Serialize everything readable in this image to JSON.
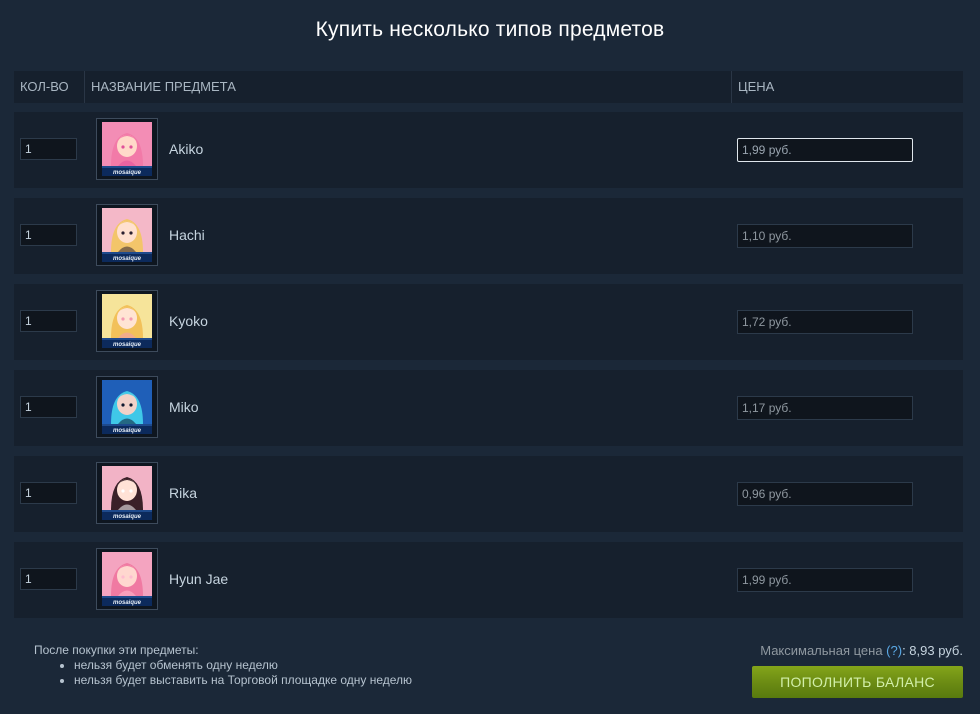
{
  "title": "Купить несколько типов предметов",
  "table": {
    "headers": {
      "qty": "КОЛ-ВО",
      "name": "НАЗВАНИЕ ПРЕДМЕТА",
      "price": "ЦЕНА"
    },
    "rows": [
      {
        "qty": "1",
        "name": "Akiko",
        "price": "1,99 руб.",
        "image": "card-portrait-akiko",
        "palette": {
          "bg": "#f38db5",
          "hair": "#f27aa8",
          "skin": "#ffd9c9",
          "accent": "#e0509a"
        }
      },
      {
        "qty": "1",
        "name": "Hachi",
        "price": "1,10 руб.",
        "image": "card-portrait-hachi",
        "palette": {
          "bg": "#f4b8c8",
          "hair": "#f3c56a",
          "skin": "#ffe0cf",
          "accent": "#2b2030"
        }
      },
      {
        "qty": "1",
        "name": "Kyoko",
        "price": "1,72 руб.",
        "image": "card-portrait-kyoko",
        "palette": {
          "bg": "#f6e49a",
          "hair": "#f2c15a",
          "skin": "#ffe4d4",
          "accent": "#f49ab2"
        }
      },
      {
        "qty": "1",
        "name": "Miko",
        "price": "1,17 руб.",
        "image": "card-portrait-miko",
        "palette": {
          "bg": "#1f5fb8",
          "hair": "#3fc8e8",
          "skin": "#f2d2c8",
          "accent": "#0e1a30"
        }
      },
      {
        "qty": "1",
        "name": "Rika",
        "price": "0,96 руб.",
        "image": "card-portrait-rika",
        "palette": {
          "bg": "#f2b3c6",
          "hair": "#3a2028",
          "skin": "#ffe2d6",
          "accent": "#ffffff"
        }
      },
      {
        "qty": "1",
        "name": "Hyun Jae",
        "price": "1,99 руб.",
        "image": "card-portrait-hyun-jae",
        "palette": {
          "bg": "#f4a4c0",
          "hair": "#f07aa2",
          "skin": "#ffd7cf",
          "accent": "#ffbcd0"
        }
      }
    ],
    "focused_price_row": 0
  },
  "notes": {
    "intro": "После покупки эти предметы:",
    "items": [
      "нельзя будет обменять одну неделю",
      "нельзя будет выставить на Торговой площадке одну неделю"
    ]
  },
  "max_price": {
    "label": "Максимальная цена",
    "help": "(?)",
    "value": ": 8,93 руб."
  },
  "fund_button": "ПОПОЛНИТЬ БАЛАНС",
  "thumb_caption": "mosaique",
  "colors": {
    "background": "#1b2838",
    "row_background": "#16202d",
    "button_green": "#6a8a13",
    "link_blue": "#5aa9e6"
  }
}
